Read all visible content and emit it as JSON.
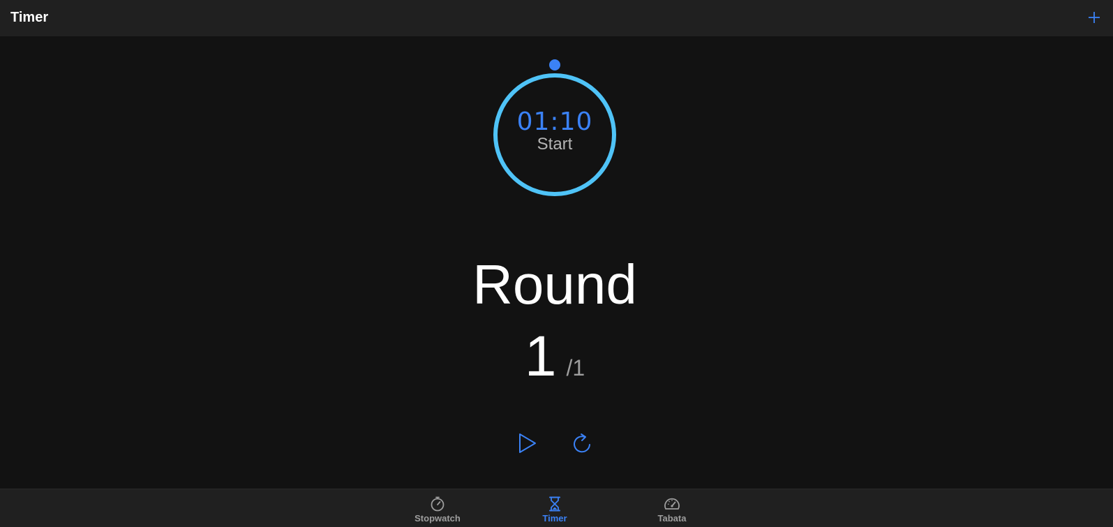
{
  "header": {
    "title": "Timer",
    "add_icon": "plus-icon"
  },
  "timer": {
    "time": "01:10",
    "action_label": "Start",
    "progress": 1.0,
    "ring_color": "#4fc3f7",
    "handle_color": "#3b82f6"
  },
  "round": {
    "label": "Round",
    "current": "1",
    "total": "/1"
  },
  "controls": {
    "play_icon": "play-icon",
    "reset_icon": "reset-icon"
  },
  "nav": {
    "items": [
      {
        "label": "Stopwatch",
        "icon": "stopwatch-icon",
        "active": false
      },
      {
        "label": "Timer",
        "icon": "hourglass-icon",
        "active": true
      },
      {
        "label": "Tabata",
        "icon": "speedometer-icon",
        "active": false
      }
    ]
  },
  "colors": {
    "accent": "#3b82f6",
    "background": "#121212",
    "bar": "#202020",
    "muted": "#9e9e9e"
  }
}
